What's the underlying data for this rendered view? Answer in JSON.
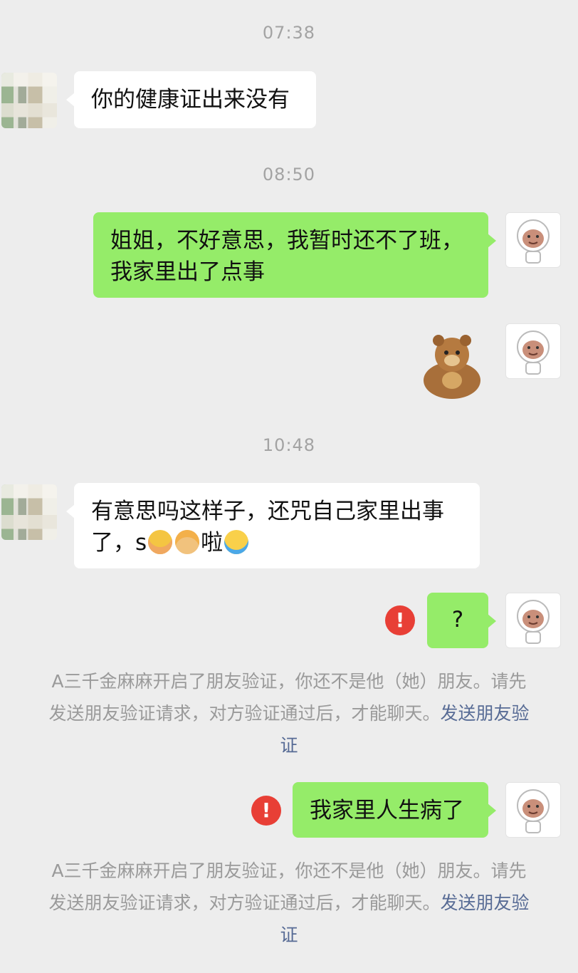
{
  "messages": {
    "t1": "07:38",
    "m1": "你的健康证出来没有",
    "t2": "08:50",
    "m2_line1": "姐姐，不好意思，我暂时还不了班，",
    "m2_line2": "我家里出了点事",
    "t3": "10:48",
    "m3_line1": "有意思吗这样子，还咒自己家里出事",
    "m3_line2_a": "了，s",
    "m3_line2_b": "啦",
    "m4": "?",
    "m5": "我家里人生病了"
  },
  "system": {
    "notice_line1": "A三千金麻麻开启了朋友验证，你还不是他（她）朋友。请先",
    "notice_line2": "发送朋友验证请求，对方验证通过后，才能聊天。",
    "notice_link_a": "发送朋友验",
    "notice_link_b": "证",
    "error_symbol": "!"
  },
  "colors": {
    "background": "#ededed",
    "sent_bubble": "#95ec69",
    "received_bubble": "#ffffff",
    "error": "#e83f36",
    "link": "#576b95"
  },
  "icons": [
    "sender-avatar-blurred",
    "my-avatar-monkey-cartoon",
    "bear-sticker",
    "woman-emoji",
    "man-emoji",
    "crying-emoji",
    "error-icon"
  ]
}
